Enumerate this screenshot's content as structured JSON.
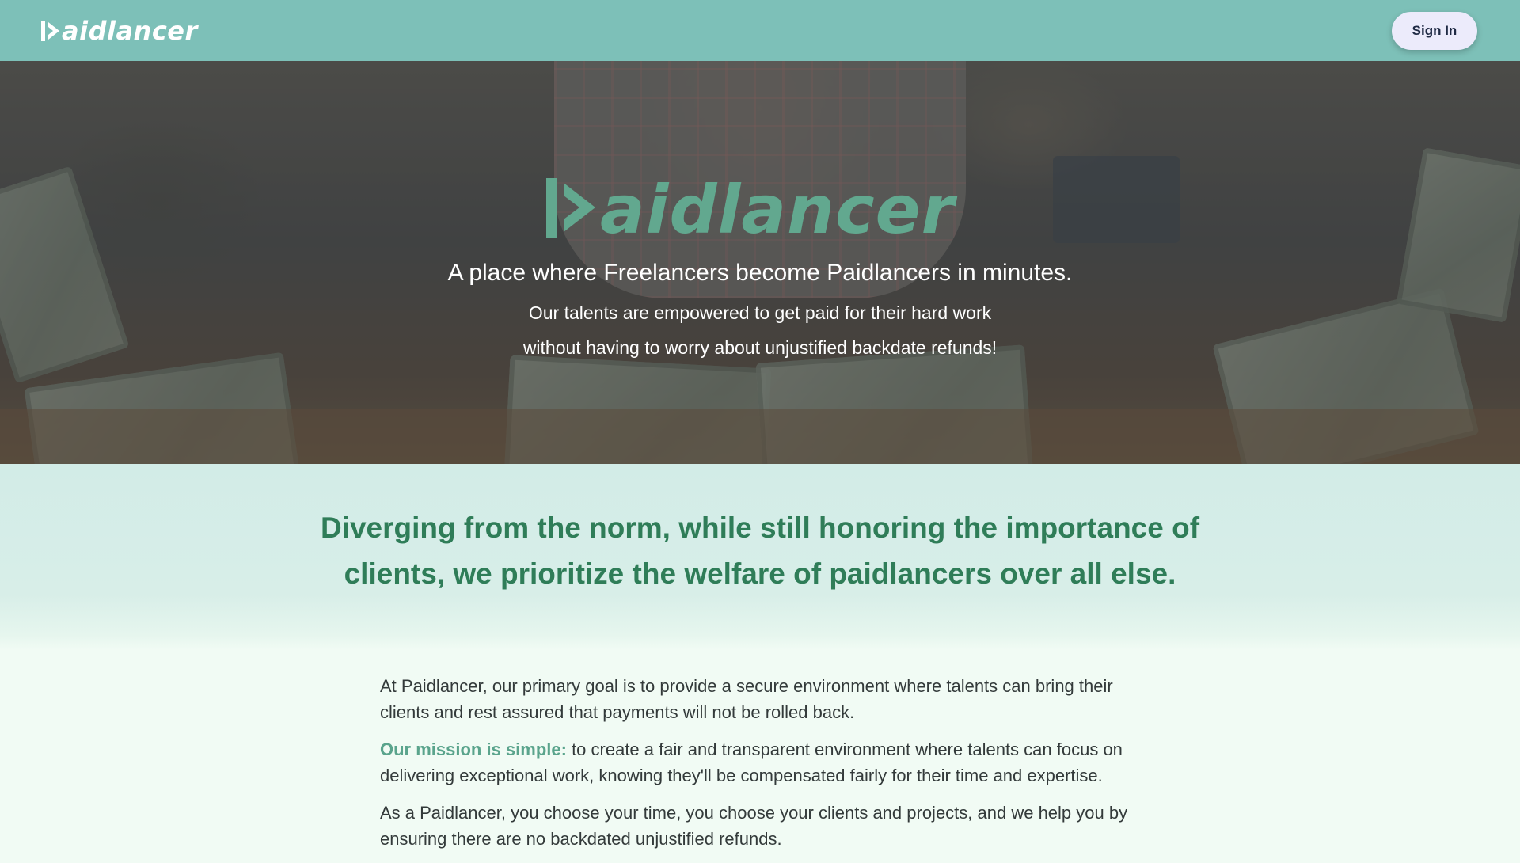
{
  "nav": {
    "brand": "aidlancer",
    "signin_label": "Sign In"
  },
  "hero": {
    "logo_text": "aidlancer",
    "tagline": "A place where Freelancers become Paidlancers in minutes.",
    "sub_line1": "Our talents are empowered to get paid for their hard work",
    "sub_line2": "without having to worry about unjustified backdate refunds!"
  },
  "headline": {
    "text": "Diverging from the norm, while still honoring the importance of clients, we prioritize the welfare of paidlancers over all else."
  },
  "about": {
    "p1": "At Paidlancer, our primary goal is to provide a secure environment where talents can bring their clients and rest assured that payments will not be rolled back.",
    "mission_lead": "Our mission is simple:",
    "mission_rest": " to create a fair and transparent environment where talents can focus on delivering exceptional work, knowing they'll be compensated fairly for their time and expertise.",
    "p3": "As a Paidlancer, you choose your time, you choose your clients and projects, and we help you by ensuring there are no backdated unjustified refunds."
  },
  "colors": {
    "nav_bg": "#7dc0b8",
    "brand_green": "#62a88f",
    "headline_green": "#2f7d58",
    "mission_green": "#5aa48c",
    "signin_bg": "#ecebfb"
  },
  "icons": {
    "brand_mark": "play-bar-icon"
  }
}
